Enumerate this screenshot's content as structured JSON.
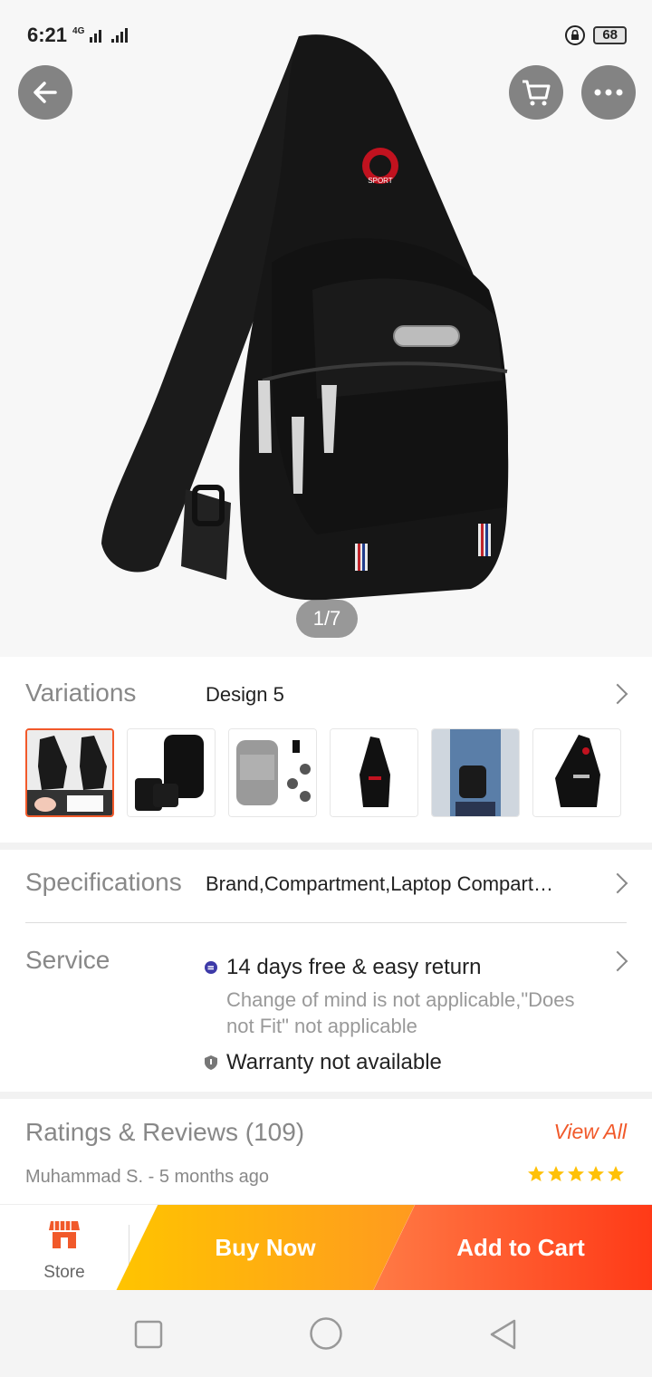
{
  "status_bar": {
    "time": "6:21",
    "network": "4G",
    "battery": "68"
  },
  "product_image": {
    "counter": "1/7",
    "badge_text": "SPORT"
  },
  "variations": {
    "label": "Variations",
    "value": "Design 5",
    "thumbnails": [
      "thumb-1",
      "thumb-2",
      "thumb-3",
      "thumb-4",
      "thumb-5",
      "thumb-6"
    ]
  },
  "specifications": {
    "label": "Specifications",
    "value": "Brand,Compartment,Laptop Compart…"
  },
  "service": {
    "label": "Service",
    "return_title": "14 days free & easy return",
    "return_note": "Change of mind is not applicable,\"Does not Fit\" not applicable",
    "warranty": "Warranty not available"
  },
  "ratings": {
    "title": "Ratings & Reviews (109)",
    "view_all": "View All",
    "reviewer": "Muhammad S. - 5 months ago",
    "stars": 5
  },
  "actions": {
    "store_label": "Store",
    "buy_now": "Buy Now",
    "add_to_cart": "Add to Cart"
  },
  "colors": {
    "accent": "#f1592a",
    "buy_now": "#ffb300",
    "add_to_cart": "#ff4a1f",
    "star": "#ffc107"
  }
}
